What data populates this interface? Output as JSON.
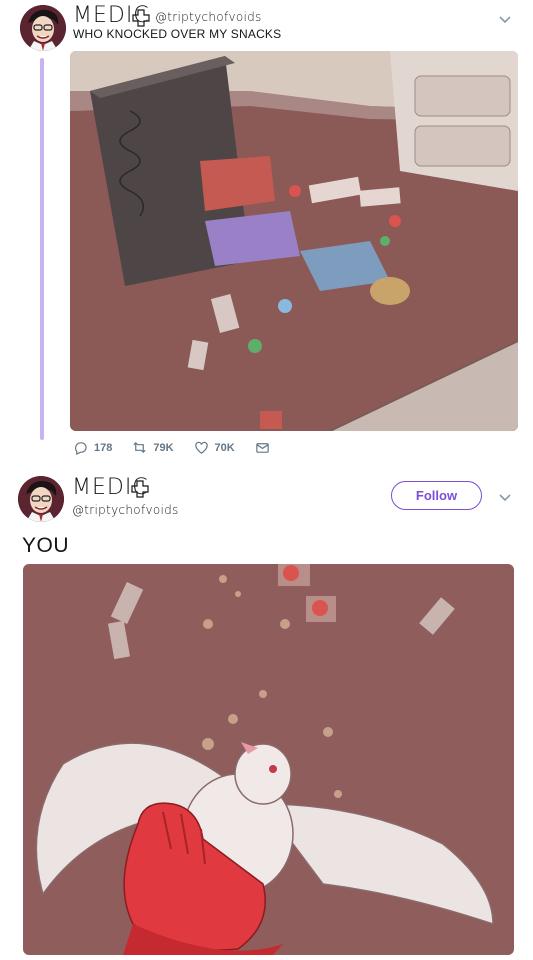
{
  "tweet1": {
    "name": "MEDIC",
    "handle": "@triptychofvoids",
    "text": "WHO KNOCKED OVER MY SNACKS",
    "counts": {
      "replies": "178",
      "retweets": "79K",
      "likes": "70K"
    }
  },
  "tweet2": {
    "name": "MEDIC",
    "handle": "@triptychofvoids",
    "follow_label": "Follow",
    "text": "YOU"
  },
  "colors": {
    "accent": "#7b4fd6",
    "thread_line": "#c8b3f2",
    "icon_gray": "#657786"
  }
}
